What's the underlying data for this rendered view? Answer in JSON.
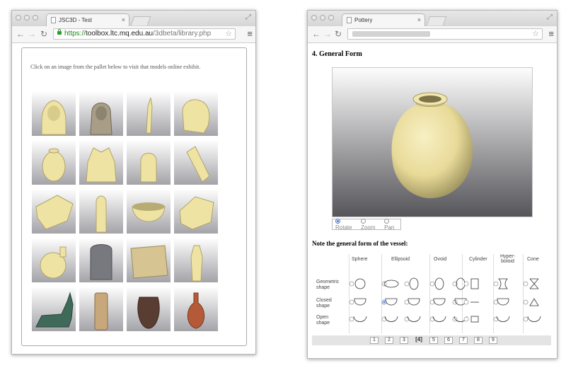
{
  "left_window": {
    "tab_title": "JSC3D - Test",
    "url": {
      "scheme": "https://",
      "host": "toolbox.ltc.mq.edu.au",
      "path": "/3dbeta/library.php"
    },
    "instruction": "Click on an image from the pallet below to visit that models online exhibit.",
    "thumbnails": [
      "sphinx-head",
      "coffin-head",
      "figurine-slim",
      "fragment-head",
      "vase-ovoid",
      "bes-mask",
      "shabti",
      "figurine-tilted",
      "fragment-flat",
      "shabti-tall",
      "bowl",
      "inscribed-fragment",
      "flask",
      "stele",
      "relief-block",
      "standing-figure",
      "anubis-jackal",
      "cylinder-jar",
      "dark-jar",
      "red-jug"
    ]
  },
  "right_window": {
    "tab_title": "Pottery",
    "section_title": "4. General Form",
    "viewer_controls": [
      "Rotate",
      "Zoom",
      "Pan"
    ],
    "selected_control": "Rotate",
    "question": "Note the general form of the vessel:",
    "columns": [
      "Sphere",
      "Ellipsoid",
      "Ovoid",
      "Cylinder",
      "Hyper-\nboloid",
      "Cone"
    ],
    "rows": [
      "Geometric\nshape",
      "Closed\nshape",
      "Open\nshape"
    ],
    "pages": [
      "1",
      "2",
      "3",
      "[4]",
      "5",
      "6",
      "7",
      "8",
      "9"
    ]
  },
  "colors": {
    "model": "#efe3a4",
    "model_shadow": "#b0a46a",
    "radio_selected": "#4a78c8",
    "https": "#1a8a1a"
  }
}
